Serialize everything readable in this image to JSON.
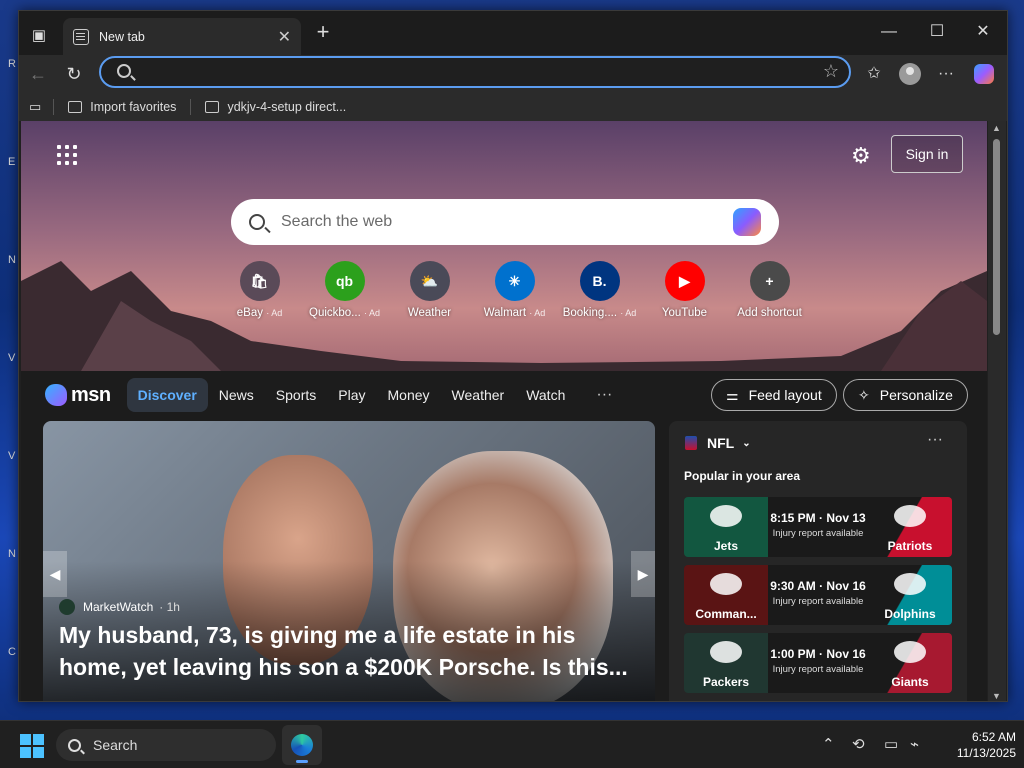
{
  "desktop": {
    "icon_letters": [
      "R",
      "E",
      "N",
      "V",
      "V",
      "N",
      "C"
    ]
  },
  "browser": {
    "tab": {
      "title": "New tab",
      "close": "✕"
    },
    "new_tab": "+",
    "window_controls": {
      "minimize": "—",
      "maximize": "☐",
      "close": "✕"
    },
    "address_bar": {
      "value": "",
      "placeholder": ""
    },
    "favorites": [
      {
        "label": "Import favorites",
        "icon": "folder-icon"
      },
      {
        "label": "ydkjv-4-setup direct...",
        "icon": "file-icon"
      }
    ]
  },
  "newtab": {
    "signin": "Sign in",
    "search_placeholder": "Search the web",
    "shortcuts": [
      {
        "label": "eBay",
        "ad": "· Ad",
        "glyph": "🛍",
        "bg": "#5a4a58"
      },
      {
        "label": "Quickbo...",
        "ad": "· Ad",
        "glyph": "qb",
        "bg": "#2ca01c"
      },
      {
        "label": "Weather",
        "ad": "",
        "glyph": "⛅",
        "bg": "#4a4a58"
      },
      {
        "label": "Walmart",
        "ad": "· Ad",
        "glyph": "✳",
        "bg": "#0071ce"
      },
      {
        "label": "Booking....",
        "ad": "· Ad",
        "glyph": "B.",
        "bg": "#003580"
      },
      {
        "label": "YouTube",
        "ad": "",
        "glyph": "▶",
        "bg": "#ff0000"
      },
      {
        "label": "Add shortcut",
        "ad": "",
        "glyph": "+",
        "bg": "#4a4a4a"
      }
    ]
  },
  "msn": {
    "logo": "msn",
    "nav": [
      "Discover",
      "News",
      "Sports",
      "Play",
      "Money",
      "Weather",
      "Watch"
    ],
    "more": "···",
    "feed_layout": "Feed layout",
    "personalize": "Personalize"
  },
  "article": {
    "source": "MarketWatch",
    "time": "· 1h",
    "headline": "My husband, 73, is giving me a life estate in his home, yet leaving his son a $200K Porsche. Is this..."
  },
  "nfl": {
    "title": "NFL",
    "more": "···",
    "subtitle": "Popular in your area",
    "games": [
      {
        "home": "Jets",
        "away": "Patriots",
        "time": "8:15 PM · Nov 13",
        "note": "Injury report available",
        "home_color": "#125740",
        "away_color": "#c8102e"
      },
      {
        "home": "Comman...",
        "away": "Dolphins",
        "time": "9:30 AM · Nov 16",
        "note": "Injury report available",
        "home_color": "#5a1414",
        "away_color": "#008e97"
      },
      {
        "home": "Packers",
        "away": "Giants",
        "time": "1:00 PM · Nov 16",
        "note": "Injury report available",
        "home_color": "#203731",
        "away_color": "#a71930"
      }
    ]
  },
  "taskbar": {
    "search": "Search",
    "time": "6:52 AM",
    "date": "11/13/2025"
  }
}
